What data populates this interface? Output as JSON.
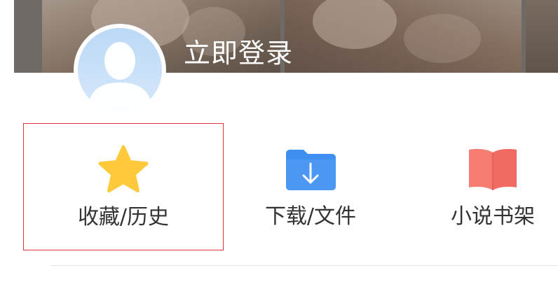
{
  "header": {
    "login_text": "立即登录"
  },
  "quick_actions": [
    {
      "label": "收藏/历史",
      "icon": "star-icon",
      "color": "#ffc93c",
      "selected": true
    },
    {
      "label": "下载/文件",
      "icon": "download-folder-icon",
      "color": "#3e8ff0",
      "selected": false
    },
    {
      "label": "小说书架",
      "icon": "open-book-icon",
      "color": "#f26b62",
      "selected": false
    }
  ],
  "colors": {
    "selection_border": "#e0363a",
    "avatar_bg": "#c9e0f8"
  }
}
